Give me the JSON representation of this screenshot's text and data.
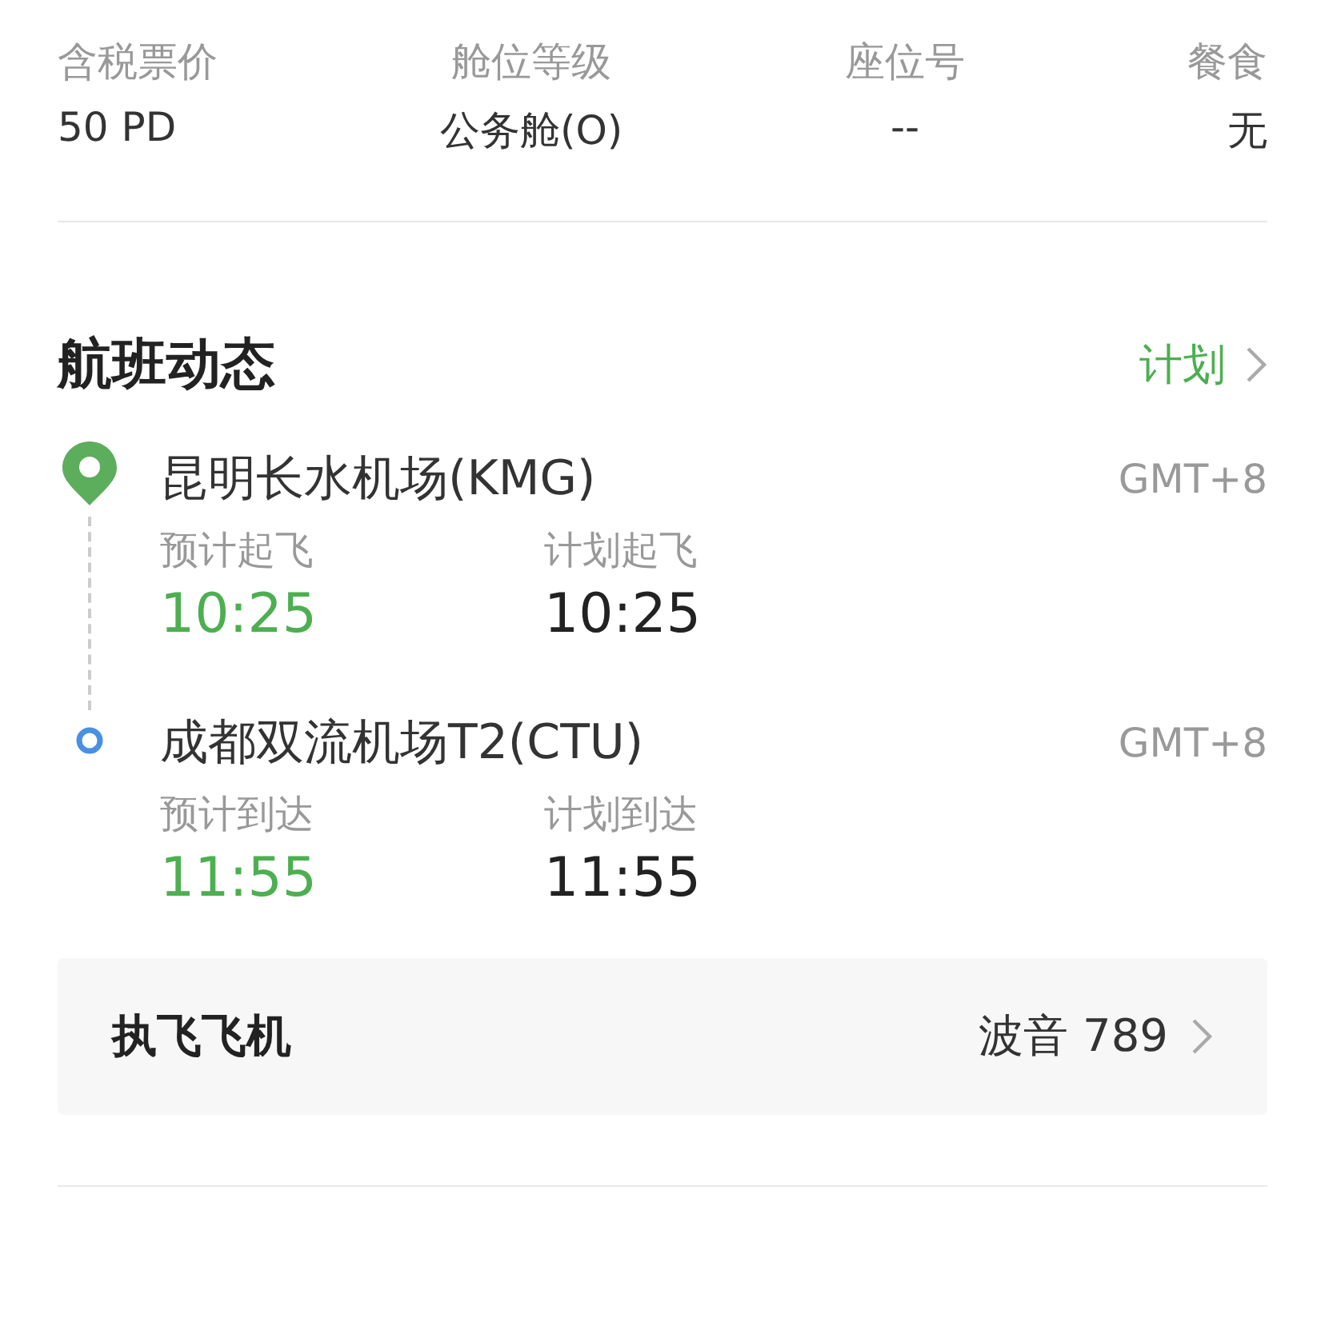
{
  "fare_info": [
    {
      "label": "含税票价",
      "value": "50 PD"
    },
    {
      "label": "舱位等级",
      "value": "公务舱(O)"
    },
    {
      "label": "座位号",
      "value": "--"
    },
    {
      "label": "餐食",
      "value": "无"
    }
  ],
  "flight_status": {
    "title": "航班动态",
    "link": "计划",
    "stops": [
      {
        "kind": "origin",
        "airport": "昆明长水机场(KMG)",
        "timezone": "GMT+8",
        "times": [
          {
            "kind": "estimated",
            "label": "预计起飞",
            "time": "10:25"
          },
          {
            "kind": "scheduled",
            "label": "计划起飞",
            "time": "10:25"
          }
        ]
      },
      {
        "kind": "destination",
        "airport": "成都双流机场T2(CTU)",
        "timezone": "GMT+8",
        "times": [
          {
            "kind": "estimated",
            "label": "预计到达",
            "time": "11:55"
          },
          {
            "kind": "scheduled",
            "label": "计划到达",
            "time": "11:55"
          }
        ]
      }
    ],
    "aircraft": {
      "label": "执飞飞机",
      "value": "波音 789"
    }
  }
}
